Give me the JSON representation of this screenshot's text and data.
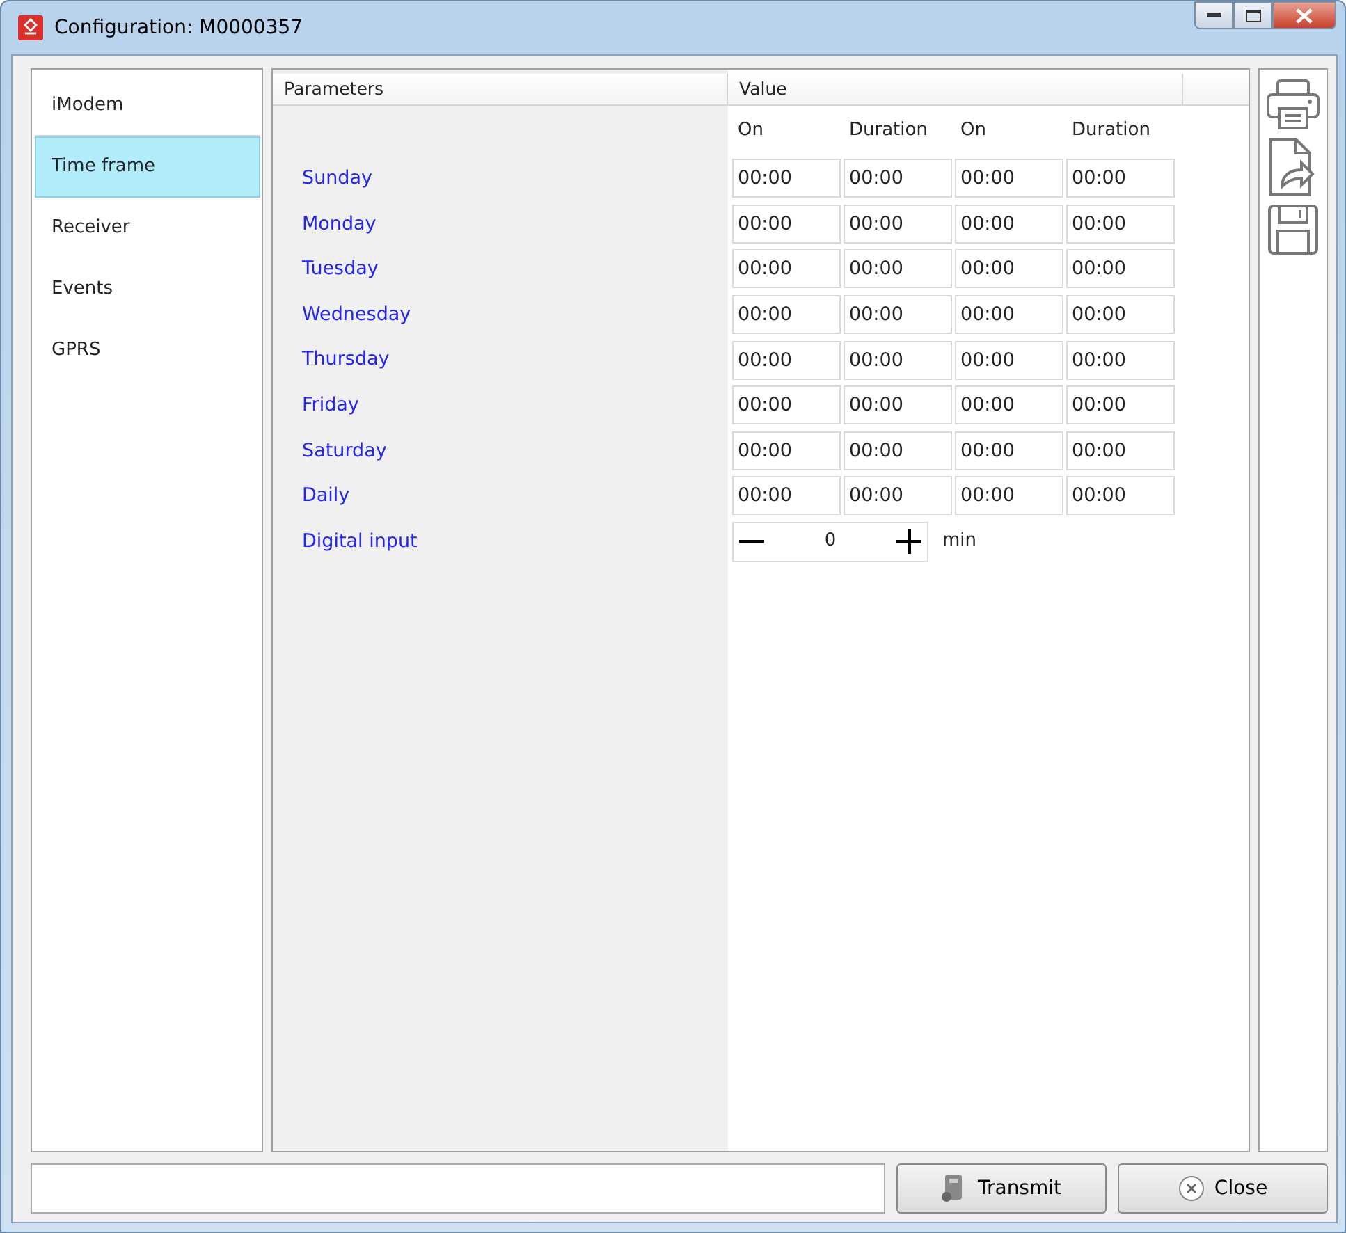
{
  "window": {
    "title": "Configuration: M0000357"
  },
  "sidebar": {
    "items": [
      {
        "label": "iModem",
        "selected": false
      },
      {
        "label": "Time frame",
        "selected": true
      },
      {
        "label": "Receiver",
        "selected": false
      },
      {
        "label": "Events",
        "selected": false
      },
      {
        "label": "GPRS",
        "selected": false
      }
    ]
  },
  "table": {
    "columns": [
      "Parameters",
      "Value"
    ],
    "subheaders": [
      "On",
      "Duration",
      "On",
      "Duration"
    ],
    "rows": [
      {
        "label": "Sunday",
        "values": [
          "00:00",
          "00:00",
          "00:00",
          "00:00"
        ]
      },
      {
        "label": "Monday",
        "values": [
          "00:00",
          "00:00",
          "00:00",
          "00:00"
        ]
      },
      {
        "label": "Tuesday",
        "values": [
          "00:00",
          "00:00",
          "00:00",
          "00:00"
        ]
      },
      {
        "label": "Wednesday",
        "values": [
          "00:00",
          "00:00",
          "00:00",
          "00:00"
        ]
      },
      {
        "label": "Thursday",
        "values": [
          "00:00",
          "00:00",
          "00:00",
          "00:00"
        ]
      },
      {
        "label": "Friday",
        "values": [
          "00:00",
          "00:00",
          "00:00",
          "00:00"
        ]
      },
      {
        "label": "Saturday",
        "values": [
          "00:00",
          "00:00",
          "00:00",
          "00:00"
        ]
      },
      {
        "label": "Daily",
        "values": [
          "00:00",
          "00:00",
          "00:00",
          "00:00"
        ]
      }
    ],
    "digital_input": {
      "label": "Digital input",
      "value": "0",
      "unit": "min"
    }
  },
  "buttons": [
    {
      "label": "Transmit",
      "kind": "transmit"
    },
    {
      "label": "Close",
      "kind": "close"
    }
  ]
}
